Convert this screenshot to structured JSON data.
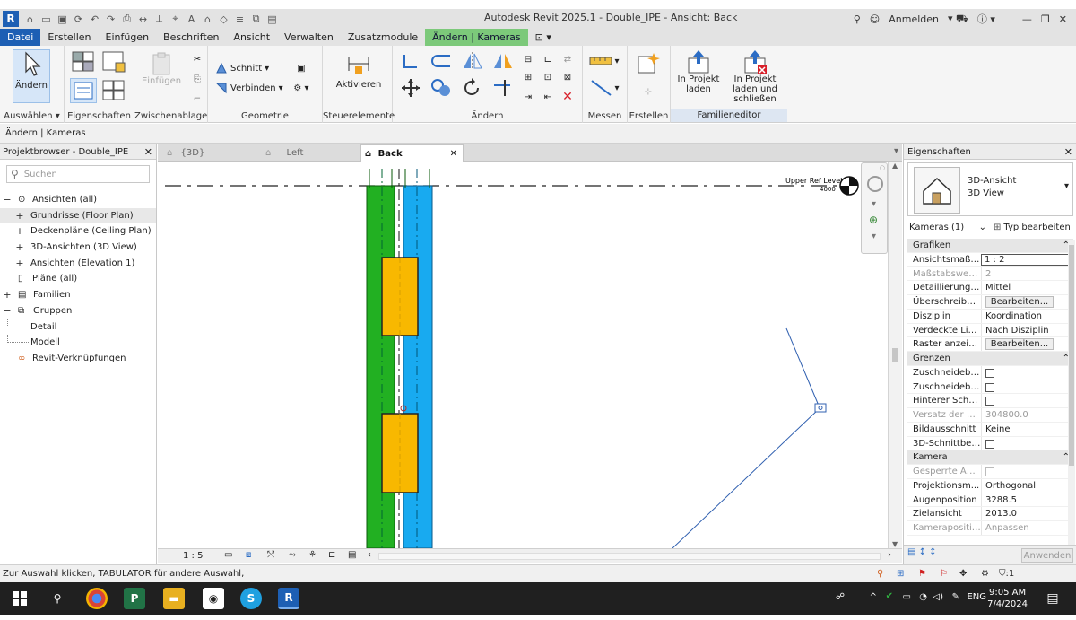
{
  "titlebar": {
    "app_logo": "R",
    "title": "Autodesk Revit 2025.1 - Double_IPE - Ansicht: Back",
    "signin": "Anmelden"
  },
  "menu": {
    "tabs": [
      "Datei",
      "Erstellen",
      "Einfügen",
      "Beschriften",
      "Ansicht",
      "Verwalten",
      "Zusatzmodule",
      "Ändern | Kameras"
    ]
  },
  "ribbon": {
    "modify": "Ändern",
    "panel_select": "Auswählen",
    "panel_props": "Eigenschaften",
    "paste": "Einfügen",
    "panel_clipboard": "Zwischenablage",
    "cut": "Schnitt",
    "join": "Verbinden",
    "panel_geometry": "Geometrie",
    "activate": "Aktivieren",
    "panel_controls": "Steuerelemente",
    "panel_modify": "Ändern",
    "panel_measure": "Messen",
    "panel_create": "Erstellen",
    "load_project": "In Projekt laden",
    "load_close": "In Projekt laden und schließen",
    "panel_family": "Familieneditor"
  },
  "optionsbar": {
    "text": "Ändern | Kameras"
  },
  "browser": {
    "title": "Projektbrowser - Double_IPE",
    "search_placeholder": "Suchen",
    "nodes": [
      {
        "label": "Ansichten (all)",
        "toggle": "−"
      },
      {
        "label": "Grundrisse (Floor Plan)",
        "toggle": "+"
      },
      {
        "label": "Deckenpläne (Ceiling Plan)",
        "toggle": "+"
      },
      {
        "label": "3D-Ansichten (3D View)",
        "toggle": "+"
      },
      {
        "label": "Ansichten (Elevation 1)",
        "toggle": "+"
      },
      {
        "label": "Pläne (all)",
        "toggle": ""
      },
      {
        "label": "Familien",
        "toggle": "+"
      },
      {
        "label": "Gruppen",
        "toggle": "−"
      },
      {
        "label": "Detail",
        "toggle": ""
      },
      {
        "label": "Modell",
        "toggle": ""
      },
      {
        "label": "Revit-Verknüpfungen",
        "toggle": ""
      }
    ]
  },
  "view_tabs": [
    {
      "label": "{3D}"
    },
    {
      "label": "Left"
    },
    {
      "label": "Back"
    }
  ],
  "canvas": {
    "level_name": "Upper Ref Level",
    "level_value": "4000"
  },
  "viewcontrol": {
    "scale": "1 : 5"
  },
  "properties": {
    "title": "Eigenschaften",
    "type_line1": "3D-Ansicht",
    "type_line2": "3D View",
    "filter": "Kameras (1)",
    "edit_type": "Typ bearbeiten",
    "rows": [
      {
        "k": "Grafiken",
        "v": "",
        "kind": "group"
      },
      {
        "k": "Ansichtsmaßs...",
        "v": "1 : 2",
        "kind": "input"
      },
      {
        "k": "Maßstabswert...",
        "v": "2",
        "kind": "dim"
      },
      {
        "k": "Detaillierungs...",
        "v": "Mittel",
        "kind": "text"
      },
      {
        "k": "Überschreibu...",
        "v": "Bearbeiten...",
        "kind": "button"
      },
      {
        "k": "Disziplin",
        "v": "Koordination",
        "kind": "text"
      },
      {
        "k": "Verdeckte Lini...",
        "v": "Nach Disziplin",
        "kind": "text"
      },
      {
        "k": "Raster anzeigen",
        "v": "Bearbeiten...",
        "kind": "button"
      },
      {
        "k": "Grenzen",
        "v": "",
        "kind": "group"
      },
      {
        "k": "Zuschneidebe...",
        "v": "",
        "kind": "check"
      },
      {
        "k": "Zuschneidebe...",
        "v": "",
        "kind": "check"
      },
      {
        "k": "Hinterer Schni...",
        "v": "",
        "kind": "check"
      },
      {
        "k": "Versatz der hi...",
        "v": "304800.0",
        "kind": "dim"
      },
      {
        "k": "Bildausschnitt",
        "v": "Keine",
        "kind": "text"
      },
      {
        "k": "3D-Schnittber...",
        "v": "",
        "kind": "check"
      },
      {
        "k": "Kamera",
        "v": "",
        "kind": "group"
      },
      {
        "k": "Gesperrte Aus...",
        "v": "",
        "kind": "checkdim"
      },
      {
        "k": "Projektionsm...",
        "v": "Orthogonal",
        "kind": "text"
      },
      {
        "k": "Augenposition",
        "v": "3288.5",
        "kind": "text"
      },
      {
        "k": "Zielansicht",
        "v": "2013.0",
        "kind": "text"
      },
      {
        "k": "Kameraposition",
        "v": "Anpassen",
        "kind": "dim"
      }
    ],
    "apply": "Anwenden"
  },
  "status": {
    "text": "Zur Auswahl klicken, TABULATOR für andere Auswahl,"
  },
  "taskbar": {
    "lang": "ENG",
    "time": "9:05 AM",
    "date": "7/4/2024",
    "filter_count": ":1"
  }
}
